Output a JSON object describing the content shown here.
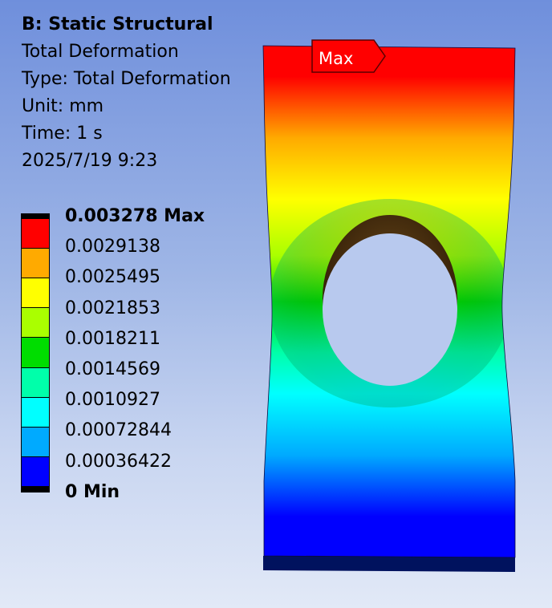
{
  "info": {
    "system": "B: Static Structural",
    "result_name": "Total Deformation",
    "type": "Type: Total Deformation",
    "unit": "Unit: mm",
    "time": "Time: 1 s",
    "timestamp": "2025/7/19 9:23"
  },
  "legend": {
    "labels": [
      "0.003278 Max",
      "0.0029138",
      "0.0025495",
      "0.0021853",
      "0.0018211",
      "0.0014569",
      "0.0010927",
      "0.00072844",
      "0.00036422",
      "0 Min"
    ],
    "colors": [
      "#ff0000",
      "#ffaa00",
      "#ffff00",
      "#aaff00",
      "#00dd00",
      "#00ffaa",
      "#00ffff",
      "#00aaff",
      "#0000ff"
    ]
  },
  "probe": {
    "label": "Max"
  },
  "model": {
    "colormap": [
      "#0000ff",
      "#00aaff",
      "#00ffff",
      "#00ffaa",
      "#00dd00",
      "#aaff00",
      "#ffff00",
      "#ffaa00",
      "#ff0000"
    ]
  }
}
